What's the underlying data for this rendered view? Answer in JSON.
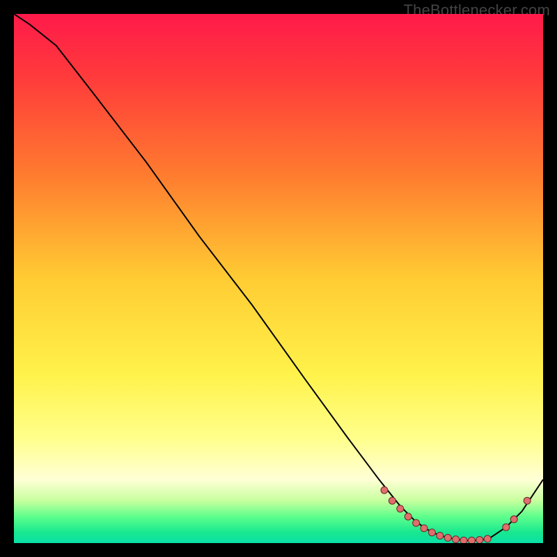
{
  "watermark": "TheBottlenecker.com",
  "colors": {
    "point_fill": "#e16d6d",
    "point_stroke": "#6b2a2a",
    "line": "#000000",
    "bg_black": "#000000"
  },
  "chart_data": {
    "type": "line",
    "title": "",
    "xlabel": "",
    "ylabel": "",
    "xlim": [
      0,
      100
    ],
    "ylim": [
      0,
      100
    ],
    "grid": false,
    "legend": false,
    "background": "rainbow-vertical-gradient",
    "gradient_stops": [
      {
        "y_pct": 0,
        "color": "#ff1a4a"
      },
      {
        "y_pct": 12,
        "color": "#ff3b3b"
      },
      {
        "y_pct": 30,
        "color": "#ff7a2f"
      },
      {
        "y_pct": 50,
        "color": "#ffcc33"
      },
      {
        "y_pct": 68,
        "color": "#fff24a"
      },
      {
        "y_pct": 80,
        "color": "#ffff8a"
      },
      {
        "y_pct": 88,
        "color": "#ffffd6"
      },
      {
        "y_pct": 92,
        "color": "#c7ff9e"
      },
      {
        "y_pct": 95,
        "color": "#5eff8c"
      },
      {
        "y_pct": 98,
        "color": "#18e88f"
      },
      {
        "y_pct": 100,
        "color": "#0be0a8"
      }
    ],
    "series": [
      {
        "name": "bottleneck-curve",
        "x": [
          0.0,
          3.0,
          8.0,
          15.0,
          25.0,
          35.0,
          45.0,
          55.0,
          63.0,
          69.0,
          73.0,
          76.0,
          79.0,
          82.0,
          85.0,
          88.0,
          90.0,
          93.0,
          96.0,
          100.0
        ],
        "y": [
          100.0,
          98.0,
          94.0,
          85.0,
          72.0,
          58.0,
          45.0,
          31.0,
          20.0,
          12.0,
          7.0,
          4.0,
          2.0,
          1.0,
          0.5,
          0.5,
          1.0,
          3.0,
          6.0,
          12.0
        ]
      }
    ],
    "points": [
      {
        "name": "p1",
        "x": 70.0,
        "y": 10.0,
        "r": 5
      },
      {
        "name": "p2",
        "x": 71.5,
        "y": 8.0,
        "r": 5
      },
      {
        "name": "p3",
        "x": 73.0,
        "y": 6.5,
        "r": 5
      },
      {
        "name": "p4",
        "x": 74.5,
        "y": 5.0,
        "r": 5
      },
      {
        "name": "p5",
        "x": 76.0,
        "y": 3.8,
        "r": 5
      },
      {
        "name": "p6",
        "x": 77.5,
        "y": 2.8,
        "r": 5
      },
      {
        "name": "p7",
        "x": 79.0,
        "y": 2.0,
        "r": 5
      },
      {
        "name": "p8",
        "x": 80.5,
        "y": 1.4,
        "r": 5
      },
      {
        "name": "p9",
        "x": 82.0,
        "y": 1.0,
        "r": 5
      },
      {
        "name": "p10",
        "x": 83.5,
        "y": 0.7,
        "r": 5
      },
      {
        "name": "p11",
        "x": 85.0,
        "y": 0.5,
        "r": 5
      },
      {
        "name": "p12",
        "x": 86.5,
        "y": 0.5,
        "r": 5
      },
      {
        "name": "p13",
        "x": 88.0,
        "y": 0.6,
        "r": 5
      },
      {
        "name": "p14",
        "x": 89.5,
        "y": 0.8,
        "r": 5
      },
      {
        "name": "p15",
        "x": 93.0,
        "y": 3.0,
        "r": 5
      },
      {
        "name": "p16",
        "x": 94.5,
        "y": 4.5,
        "r": 5
      },
      {
        "name": "p17",
        "x": 97.0,
        "y": 8.0,
        "r": 5
      }
    ]
  }
}
